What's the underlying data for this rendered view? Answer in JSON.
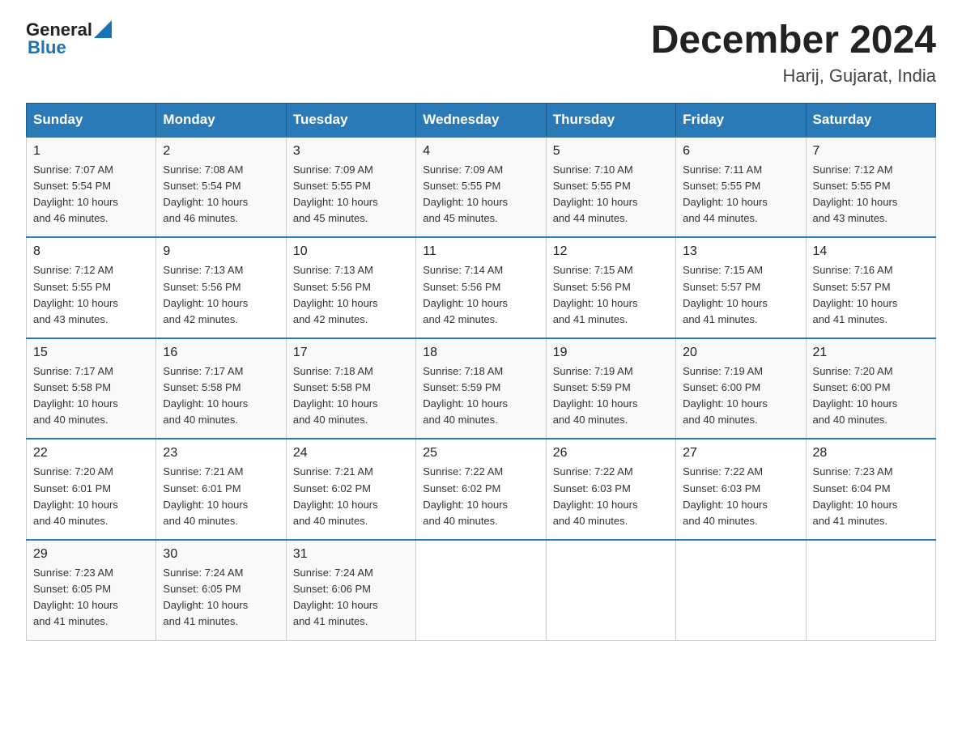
{
  "logo": {
    "general": "General",
    "triangle": "▲",
    "blue": "Blue"
  },
  "title": "December 2024",
  "subtitle": "Harij, Gujarat, India",
  "days_of_week": [
    "Sunday",
    "Monday",
    "Tuesday",
    "Wednesday",
    "Thursday",
    "Friday",
    "Saturday"
  ],
  "weeks": [
    [
      {
        "day": "1",
        "sunrise": "7:07 AM",
        "sunset": "5:54 PM",
        "daylight": "10 hours and 46 minutes."
      },
      {
        "day": "2",
        "sunrise": "7:08 AM",
        "sunset": "5:54 PM",
        "daylight": "10 hours and 46 minutes."
      },
      {
        "day": "3",
        "sunrise": "7:09 AM",
        "sunset": "5:55 PM",
        "daylight": "10 hours and 45 minutes."
      },
      {
        "day": "4",
        "sunrise": "7:09 AM",
        "sunset": "5:55 PM",
        "daylight": "10 hours and 45 minutes."
      },
      {
        "day": "5",
        "sunrise": "7:10 AM",
        "sunset": "5:55 PM",
        "daylight": "10 hours and 44 minutes."
      },
      {
        "day": "6",
        "sunrise": "7:11 AM",
        "sunset": "5:55 PM",
        "daylight": "10 hours and 44 minutes."
      },
      {
        "day": "7",
        "sunrise": "7:12 AM",
        "sunset": "5:55 PM",
        "daylight": "10 hours and 43 minutes."
      }
    ],
    [
      {
        "day": "8",
        "sunrise": "7:12 AM",
        "sunset": "5:55 PM",
        "daylight": "10 hours and 43 minutes."
      },
      {
        "day": "9",
        "sunrise": "7:13 AM",
        "sunset": "5:56 PM",
        "daylight": "10 hours and 42 minutes."
      },
      {
        "day": "10",
        "sunrise": "7:13 AM",
        "sunset": "5:56 PM",
        "daylight": "10 hours and 42 minutes."
      },
      {
        "day": "11",
        "sunrise": "7:14 AM",
        "sunset": "5:56 PM",
        "daylight": "10 hours and 42 minutes."
      },
      {
        "day": "12",
        "sunrise": "7:15 AM",
        "sunset": "5:56 PM",
        "daylight": "10 hours and 41 minutes."
      },
      {
        "day": "13",
        "sunrise": "7:15 AM",
        "sunset": "5:57 PM",
        "daylight": "10 hours and 41 minutes."
      },
      {
        "day": "14",
        "sunrise": "7:16 AM",
        "sunset": "5:57 PM",
        "daylight": "10 hours and 41 minutes."
      }
    ],
    [
      {
        "day": "15",
        "sunrise": "7:17 AM",
        "sunset": "5:58 PM",
        "daylight": "10 hours and 40 minutes."
      },
      {
        "day": "16",
        "sunrise": "7:17 AM",
        "sunset": "5:58 PM",
        "daylight": "10 hours and 40 minutes."
      },
      {
        "day": "17",
        "sunrise": "7:18 AM",
        "sunset": "5:58 PM",
        "daylight": "10 hours and 40 minutes."
      },
      {
        "day": "18",
        "sunrise": "7:18 AM",
        "sunset": "5:59 PM",
        "daylight": "10 hours and 40 minutes."
      },
      {
        "day": "19",
        "sunrise": "7:19 AM",
        "sunset": "5:59 PM",
        "daylight": "10 hours and 40 minutes."
      },
      {
        "day": "20",
        "sunrise": "7:19 AM",
        "sunset": "6:00 PM",
        "daylight": "10 hours and 40 minutes."
      },
      {
        "day": "21",
        "sunrise": "7:20 AM",
        "sunset": "6:00 PM",
        "daylight": "10 hours and 40 minutes."
      }
    ],
    [
      {
        "day": "22",
        "sunrise": "7:20 AM",
        "sunset": "6:01 PM",
        "daylight": "10 hours and 40 minutes."
      },
      {
        "day": "23",
        "sunrise": "7:21 AM",
        "sunset": "6:01 PM",
        "daylight": "10 hours and 40 minutes."
      },
      {
        "day": "24",
        "sunrise": "7:21 AM",
        "sunset": "6:02 PM",
        "daylight": "10 hours and 40 minutes."
      },
      {
        "day": "25",
        "sunrise": "7:22 AM",
        "sunset": "6:02 PM",
        "daylight": "10 hours and 40 minutes."
      },
      {
        "day": "26",
        "sunrise": "7:22 AM",
        "sunset": "6:03 PM",
        "daylight": "10 hours and 40 minutes."
      },
      {
        "day": "27",
        "sunrise": "7:22 AM",
        "sunset": "6:03 PM",
        "daylight": "10 hours and 40 minutes."
      },
      {
        "day": "28",
        "sunrise": "7:23 AM",
        "sunset": "6:04 PM",
        "daylight": "10 hours and 41 minutes."
      }
    ],
    [
      {
        "day": "29",
        "sunrise": "7:23 AM",
        "sunset": "6:05 PM",
        "daylight": "10 hours and 41 minutes."
      },
      {
        "day": "30",
        "sunrise": "7:24 AM",
        "sunset": "6:05 PM",
        "daylight": "10 hours and 41 minutes."
      },
      {
        "day": "31",
        "sunrise": "7:24 AM",
        "sunset": "6:06 PM",
        "daylight": "10 hours and 41 minutes."
      },
      null,
      null,
      null,
      null
    ]
  ],
  "labels": {
    "sunrise": "Sunrise:",
    "sunset": "Sunset:",
    "daylight": "Daylight:"
  }
}
